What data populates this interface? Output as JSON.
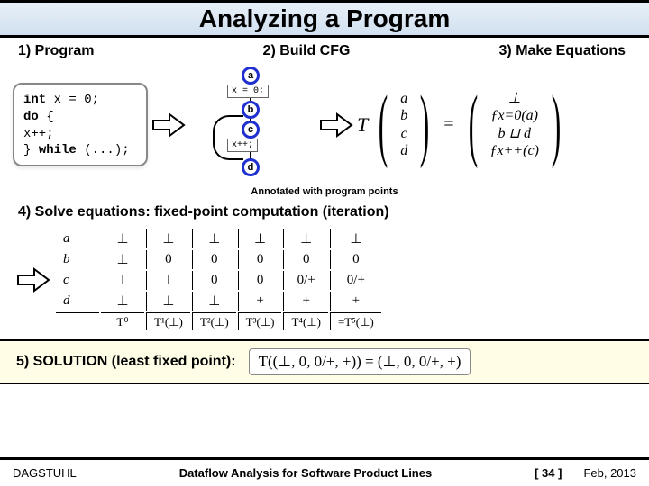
{
  "title": "Analyzing a Program",
  "steps": {
    "s1": "1) Program",
    "s2": "2) Build CFG",
    "s3": "3) Make Equations",
    "s4": "4) Solve equations: fixed-point computation (iteration)",
    "s5": "5) SOLUTION (least fixed point):"
  },
  "program": {
    "l1a": "int",
    "l1b": " x = 0;",
    "l2a": "do",
    "l2b": " {",
    "l3": "  x++;",
    "l4a": "} ",
    "l4b": "while",
    "l4c": " (...);"
  },
  "cfg": {
    "a": "a",
    "b": "b",
    "c": "c",
    "d": "d",
    "box1": "x = 0;",
    "box2": "x++;",
    "annot": "Annotated with program points"
  },
  "equations": {
    "T": "T",
    "eq": "=",
    "vars": [
      "a",
      "b",
      "c",
      "d"
    ],
    "rhs": [
      "⊥",
      "f_{x=0}(a)",
      "b ⊔ d",
      "f_{x++}(c)"
    ],
    "rhs_display": [
      "⊥",
      "ƒx=0(a)",
      "b ⊔ d",
      "ƒx++(c)"
    ]
  },
  "iteration": {
    "labels": [
      "a",
      "b",
      "c",
      "d"
    ],
    "cols": [
      [
        "⊥",
        "⊥",
        "⊥",
        "⊥"
      ],
      [
        "⊥",
        "0",
        "⊥",
        "⊥"
      ],
      [
        "⊥",
        "0",
        "0",
        "⊥"
      ],
      [
        "⊥",
        "0",
        "0",
        "+"
      ],
      [
        "⊥",
        "0",
        "0/+",
        "+"
      ],
      [
        "⊥",
        "0",
        "0/+",
        "+"
      ]
    ],
    "headers": [
      "T⁰",
      "T¹(⊥)",
      "T²(⊥)",
      "T³(⊥)",
      "T⁴(⊥)",
      "=T⁵(⊥)"
    ]
  },
  "solution": "T((⊥, 0, 0/+, +)) = (⊥, 0, 0/+, +)",
  "footer": {
    "left": "DAGSTUHL",
    "center": "Dataflow Analysis for Software Product Lines",
    "page": "[ 34 ]",
    "right": "Feb, 2013"
  }
}
